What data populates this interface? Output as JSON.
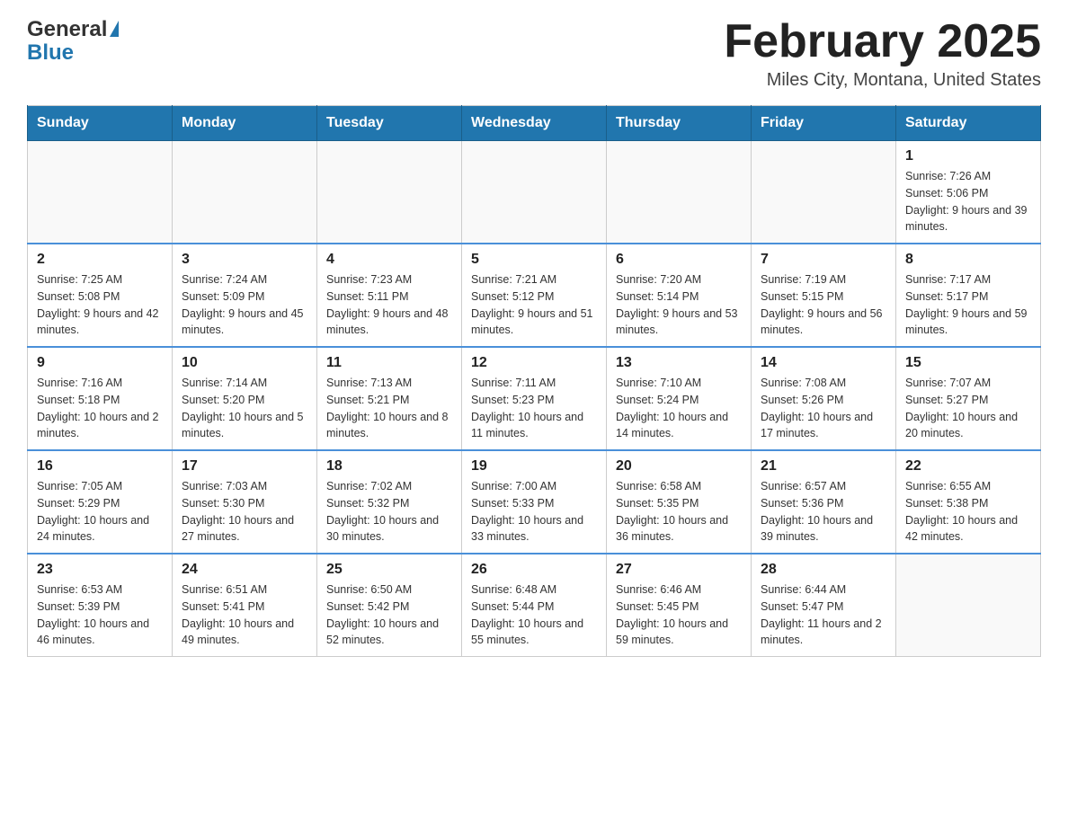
{
  "header": {
    "logo_general": "General",
    "logo_blue": "Blue",
    "month_title": "February 2025",
    "location": "Miles City, Montana, United States"
  },
  "days_of_week": [
    "Sunday",
    "Monday",
    "Tuesday",
    "Wednesday",
    "Thursday",
    "Friday",
    "Saturday"
  ],
  "weeks": [
    [
      {
        "day": "",
        "sunrise": "",
        "sunset": "",
        "daylight": ""
      },
      {
        "day": "",
        "sunrise": "",
        "sunset": "",
        "daylight": ""
      },
      {
        "day": "",
        "sunrise": "",
        "sunset": "",
        "daylight": ""
      },
      {
        "day": "",
        "sunrise": "",
        "sunset": "",
        "daylight": ""
      },
      {
        "day": "",
        "sunrise": "",
        "sunset": "",
        "daylight": ""
      },
      {
        "day": "",
        "sunrise": "",
        "sunset": "",
        "daylight": ""
      },
      {
        "day": "1",
        "sunrise": "Sunrise: 7:26 AM",
        "sunset": "Sunset: 5:06 PM",
        "daylight": "Daylight: 9 hours and 39 minutes."
      }
    ],
    [
      {
        "day": "2",
        "sunrise": "Sunrise: 7:25 AM",
        "sunset": "Sunset: 5:08 PM",
        "daylight": "Daylight: 9 hours and 42 minutes."
      },
      {
        "day": "3",
        "sunrise": "Sunrise: 7:24 AM",
        "sunset": "Sunset: 5:09 PM",
        "daylight": "Daylight: 9 hours and 45 minutes."
      },
      {
        "day": "4",
        "sunrise": "Sunrise: 7:23 AM",
        "sunset": "Sunset: 5:11 PM",
        "daylight": "Daylight: 9 hours and 48 minutes."
      },
      {
        "day": "5",
        "sunrise": "Sunrise: 7:21 AM",
        "sunset": "Sunset: 5:12 PM",
        "daylight": "Daylight: 9 hours and 51 minutes."
      },
      {
        "day": "6",
        "sunrise": "Sunrise: 7:20 AM",
        "sunset": "Sunset: 5:14 PM",
        "daylight": "Daylight: 9 hours and 53 minutes."
      },
      {
        "day": "7",
        "sunrise": "Sunrise: 7:19 AM",
        "sunset": "Sunset: 5:15 PM",
        "daylight": "Daylight: 9 hours and 56 minutes."
      },
      {
        "day": "8",
        "sunrise": "Sunrise: 7:17 AM",
        "sunset": "Sunset: 5:17 PM",
        "daylight": "Daylight: 9 hours and 59 minutes."
      }
    ],
    [
      {
        "day": "9",
        "sunrise": "Sunrise: 7:16 AM",
        "sunset": "Sunset: 5:18 PM",
        "daylight": "Daylight: 10 hours and 2 minutes."
      },
      {
        "day": "10",
        "sunrise": "Sunrise: 7:14 AM",
        "sunset": "Sunset: 5:20 PM",
        "daylight": "Daylight: 10 hours and 5 minutes."
      },
      {
        "day": "11",
        "sunrise": "Sunrise: 7:13 AM",
        "sunset": "Sunset: 5:21 PM",
        "daylight": "Daylight: 10 hours and 8 minutes."
      },
      {
        "day": "12",
        "sunrise": "Sunrise: 7:11 AM",
        "sunset": "Sunset: 5:23 PM",
        "daylight": "Daylight: 10 hours and 11 minutes."
      },
      {
        "day": "13",
        "sunrise": "Sunrise: 7:10 AM",
        "sunset": "Sunset: 5:24 PM",
        "daylight": "Daylight: 10 hours and 14 minutes."
      },
      {
        "day": "14",
        "sunrise": "Sunrise: 7:08 AM",
        "sunset": "Sunset: 5:26 PM",
        "daylight": "Daylight: 10 hours and 17 minutes."
      },
      {
        "day": "15",
        "sunrise": "Sunrise: 7:07 AM",
        "sunset": "Sunset: 5:27 PM",
        "daylight": "Daylight: 10 hours and 20 minutes."
      }
    ],
    [
      {
        "day": "16",
        "sunrise": "Sunrise: 7:05 AM",
        "sunset": "Sunset: 5:29 PM",
        "daylight": "Daylight: 10 hours and 24 minutes."
      },
      {
        "day": "17",
        "sunrise": "Sunrise: 7:03 AM",
        "sunset": "Sunset: 5:30 PM",
        "daylight": "Daylight: 10 hours and 27 minutes."
      },
      {
        "day": "18",
        "sunrise": "Sunrise: 7:02 AM",
        "sunset": "Sunset: 5:32 PM",
        "daylight": "Daylight: 10 hours and 30 minutes."
      },
      {
        "day": "19",
        "sunrise": "Sunrise: 7:00 AM",
        "sunset": "Sunset: 5:33 PM",
        "daylight": "Daylight: 10 hours and 33 minutes."
      },
      {
        "day": "20",
        "sunrise": "Sunrise: 6:58 AM",
        "sunset": "Sunset: 5:35 PM",
        "daylight": "Daylight: 10 hours and 36 minutes."
      },
      {
        "day": "21",
        "sunrise": "Sunrise: 6:57 AM",
        "sunset": "Sunset: 5:36 PM",
        "daylight": "Daylight: 10 hours and 39 minutes."
      },
      {
        "day": "22",
        "sunrise": "Sunrise: 6:55 AM",
        "sunset": "Sunset: 5:38 PM",
        "daylight": "Daylight: 10 hours and 42 minutes."
      }
    ],
    [
      {
        "day": "23",
        "sunrise": "Sunrise: 6:53 AM",
        "sunset": "Sunset: 5:39 PM",
        "daylight": "Daylight: 10 hours and 46 minutes."
      },
      {
        "day": "24",
        "sunrise": "Sunrise: 6:51 AM",
        "sunset": "Sunset: 5:41 PM",
        "daylight": "Daylight: 10 hours and 49 minutes."
      },
      {
        "day": "25",
        "sunrise": "Sunrise: 6:50 AM",
        "sunset": "Sunset: 5:42 PM",
        "daylight": "Daylight: 10 hours and 52 minutes."
      },
      {
        "day": "26",
        "sunrise": "Sunrise: 6:48 AM",
        "sunset": "Sunset: 5:44 PM",
        "daylight": "Daylight: 10 hours and 55 minutes."
      },
      {
        "day": "27",
        "sunrise": "Sunrise: 6:46 AM",
        "sunset": "Sunset: 5:45 PM",
        "daylight": "Daylight: 10 hours and 59 minutes."
      },
      {
        "day": "28",
        "sunrise": "Sunrise: 6:44 AM",
        "sunset": "Sunset: 5:47 PM",
        "daylight": "Daylight: 11 hours and 2 minutes."
      },
      {
        "day": "",
        "sunrise": "",
        "sunset": "",
        "daylight": ""
      }
    ]
  ]
}
